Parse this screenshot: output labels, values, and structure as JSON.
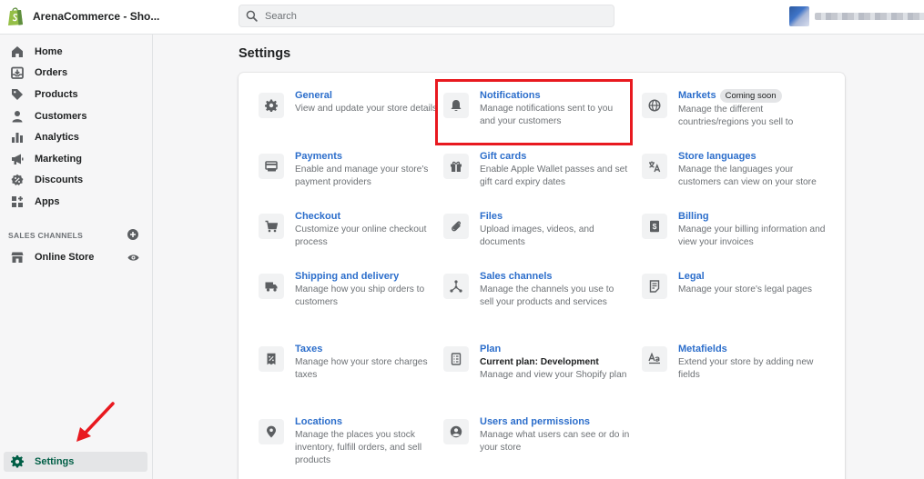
{
  "app": {
    "store_name": "ArenaCommerce - Sho...",
    "logo_icon": "shopify-bag-icon"
  },
  "search": {
    "placeholder": "Search",
    "value": "",
    "icon": "search-icon"
  },
  "account": {
    "avatar_icon": "avatar-icon"
  },
  "sidebar": {
    "items": [
      {
        "label": "Home",
        "icon": "home-icon"
      },
      {
        "label": "Orders",
        "icon": "orders-icon"
      },
      {
        "label": "Products",
        "icon": "tag-icon"
      },
      {
        "label": "Customers",
        "icon": "person-icon"
      },
      {
        "label": "Analytics",
        "icon": "bar-chart-icon"
      },
      {
        "label": "Marketing",
        "icon": "megaphone-icon"
      },
      {
        "label": "Discounts",
        "icon": "discount-icon"
      },
      {
        "label": "Apps",
        "icon": "apps-icon"
      }
    ],
    "sales_channels_label": "SALES CHANNELS",
    "online_store_label": "Online Store",
    "settings_label": "Settings"
  },
  "page": {
    "title": "Settings"
  },
  "settings": {
    "general": {
      "title": "General",
      "description": "View and update your store details"
    },
    "notifications": {
      "title": "Notifications",
      "description": "Manage notifications sent to you and your customers"
    },
    "markets": {
      "title": "Markets",
      "badge": "Coming soon",
      "description": "Manage the different countries/regions you sell to"
    },
    "payments": {
      "title": "Payments",
      "description": "Enable and manage your store's payment providers"
    },
    "gift_cards": {
      "title": "Gift cards",
      "description": "Enable Apple Wallet passes and set gift card expiry dates"
    },
    "store_languages": {
      "title": "Store languages",
      "description": "Manage the languages your customers can view on your store"
    },
    "checkout": {
      "title": "Checkout",
      "description": "Customize your online checkout process"
    },
    "files": {
      "title": "Files",
      "description": "Upload images, videos, and documents"
    },
    "billing": {
      "title": "Billing",
      "description": "Manage your billing information and view your invoices"
    },
    "shipping": {
      "title": "Shipping and delivery",
      "description": "Manage how you ship orders to customers"
    },
    "sales_channels": {
      "title": "Sales channels",
      "description": "Manage the channels you use to sell your products and services"
    },
    "legal": {
      "title": "Legal",
      "description": "Manage your store's legal pages"
    },
    "taxes": {
      "title": "Taxes",
      "description": "Manage how your store charges taxes"
    },
    "plan": {
      "title": "Plan",
      "current_plan": "Current plan: Development",
      "description": "Manage and view your Shopify plan"
    },
    "metafields": {
      "title": "Metafields",
      "description": "Extend your store by adding new fields"
    },
    "locations": {
      "title": "Locations",
      "description": "Manage the places you stock inventory, fulfill orders, and sell products"
    },
    "users": {
      "title": "Users and permissions",
      "description": "Manage what users can see or do in your store"
    }
  },
  "colors": {
    "link": "#2c6ecb",
    "highlight_box": "#e8191f",
    "active_nav": "#005e46",
    "annotation_arrow": "#e8191f"
  }
}
